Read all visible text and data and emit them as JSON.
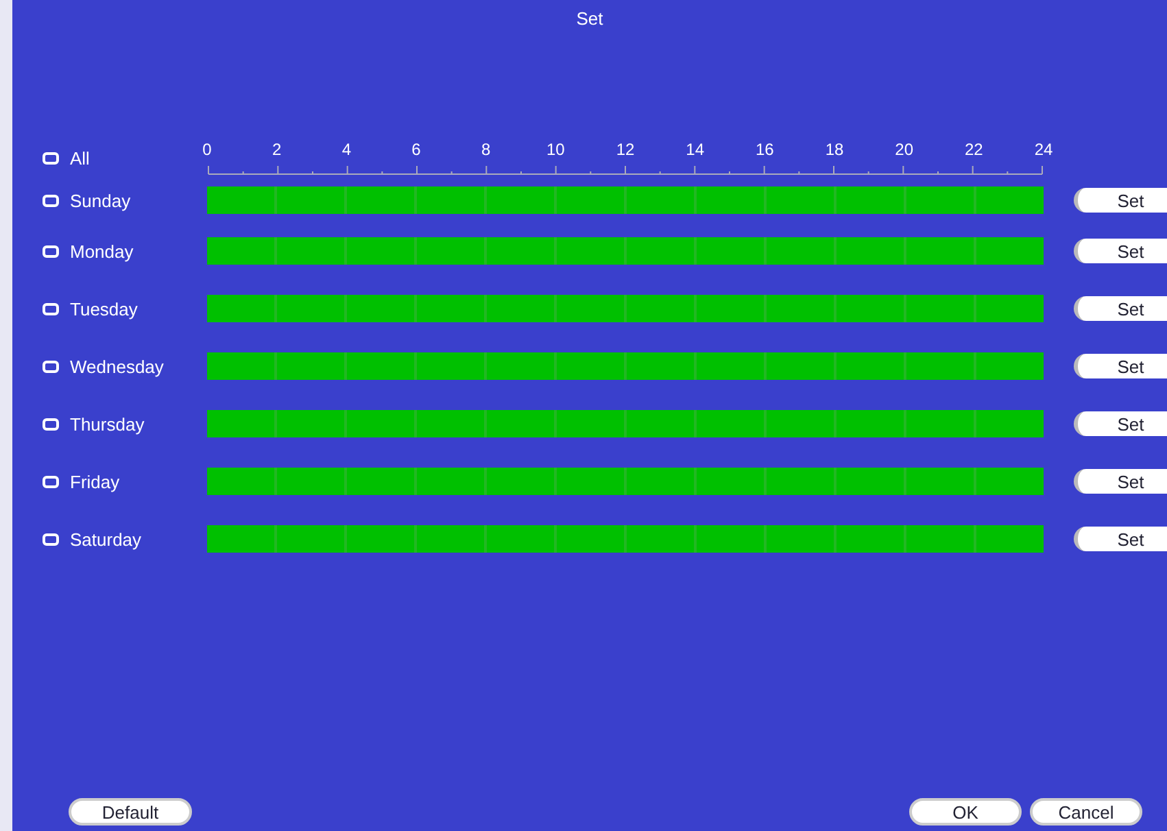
{
  "window": {
    "title": "Set"
  },
  "all": {
    "label": "All",
    "checked": false
  },
  "ruler": {
    "ticks": [
      "0",
      "2",
      "4",
      "6",
      "8",
      "10",
      "12",
      "14",
      "16",
      "18",
      "20",
      "22",
      "24"
    ]
  },
  "days": [
    {
      "label": "Sunday",
      "checked": false,
      "level": 1,
      "button": "Set"
    },
    {
      "label": "Monday",
      "checked": false,
      "level": 1,
      "button": "Set"
    },
    {
      "label": "Tuesday",
      "checked": false,
      "level": 1,
      "button": "Set"
    },
    {
      "label": "Wednesday",
      "checked": false,
      "level": 1,
      "button": "Set"
    },
    {
      "label": "Thursday",
      "checked": false,
      "level": 1,
      "button": "Set"
    },
    {
      "label": "Friday",
      "checked": false,
      "level": 1,
      "button": "Set"
    },
    {
      "label": "Saturday",
      "checked": false,
      "level": 1,
      "button": "Set"
    }
  ],
  "buttons": {
    "default": "Default",
    "ok": "OK",
    "cancel": "Cancel"
  }
}
